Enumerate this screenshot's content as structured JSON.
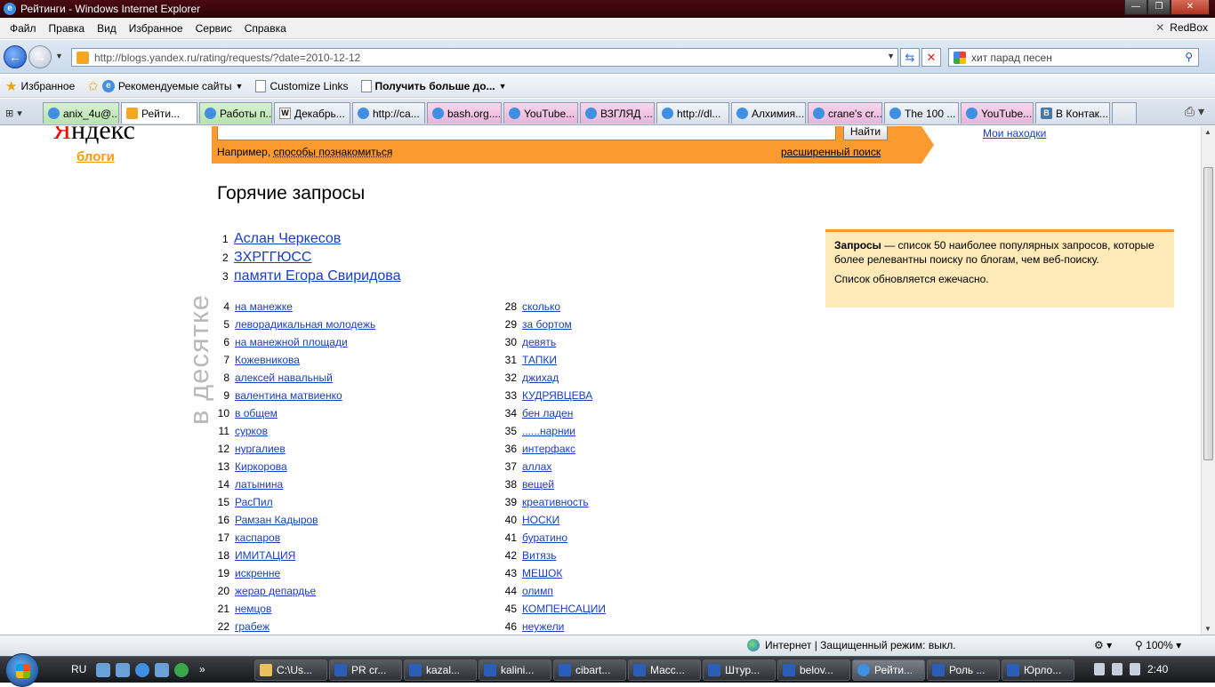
{
  "window": {
    "title": "Рейтинги - Windows Internet Explorer"
  },
  "menu": {
    "items": [
      "Файл",
      "Правка",
      "Вид",
      "Избранное",
      "Сервис",
      "Справка"
    ],
    "redbox": "RedBox"
  },
  "address": {
    "url": "http://blogs.yandex.ru/rating/requests/?date=2010-12-12"
  },
  "websearch": {
    "value": "хит парад песен"
  },
  "favorites": {
    "label": "Избранное",
    "items": [
      "Рекомендуемые сайты",
      "Customize Links",
      "Получить больше до..."
    ]
  },
  "tabs": [
    {
      "label": "anix_4u@...",
      "color": "green"
    },
    {
      "label": "Рейти...",
      "color": "active"
    },
    {
      "label": "Работы п...",
      "color": "green"
    },
    {
      "label": "Декабрь...",
      "color": "plain"
    },
    {
      "label": "http://ca...",
      "color": "plain"
    },
    {
      "label": "bash.org....",
      "color": "pink"
    },
    {
      "label": "YouTube...",
      "color": "pink"
    },
    {
      "label": "ВЗГЛЯД ...",
      "color": "pink"
    },
    {
      "label": "http://dl...",
      "color": "plain"
    },
    {
      "label": "Алхимия...",
      "color": "plain"
    },
    {
      "label": "crane's cr...",
      "color": "pink"
    },
    {
      "label": "The 100 ...",
      "color": "plain"
    },
    {
      "label": "YouTube...",
      "color": "pink"
    },
    {
      "label": "В Контак...",
      "color": "plain"
    }
  ],
  "page": {
    "logo": "Яндекс",
    "logo_sub": "блоги",
    "search_button": "Найти",
    "example_prefix": "Например,",
    "example_link": "способы познакомиться",
    "advanced_search": "расширенный поиск",
    "my_finds": "Мои находки",
    "heading": "Горячие запросы",
    "vertical_label": "в десятке",
    "top3": [
      {
        "n": "1",
        "text": "Аслан Черкесов"
      },
      {
        "n": "2",
        "text": "ЗХРГГЮСС"
      },
      {
        "n": "3",
        "text": "памяти Егора Свиридова"
      }
    ],
    "col1": [
      {
        "n": "4",
        "text": "на манежке"
      },
      {
        "n": "5",
        "text": "леворадикальная молодежь"
      },
      {
        "n": "6",
        "text": "на манежной площади"
      },
      {
        "n": "7",
        "text": "Кожевникова"
      },
      {
        "n": "8",
        "text": "алексей навальный"
      },
      {
        "n": "9",
        "text": "валентина матвиенко"
      },
      {
        "n": "10",
        "text": "в общем"
      },
      {
        "n": "11",
        "text": "сурков"
      },
      {
        "n": "12",
        "text": "нургалиев"
      },
      {
        "n": "13",
        "text": "Киркорова"
      },
      {
        "n": "14",
        "text": "латынина"
      },
      {
        "n": "15",
        "text": "РасПил"
      },
      {
        "n": "16",
        "text": "Рамзан Кадыров"
      },
      {
        "n": "17",
        "text": "каспаров"
      },
      {
        "n": "18",
        "text": "ИМИТАЦИЯ"
      },
      {
        "n": "19",
        "text": "искренне"
      },
      {
        "n": "20",
        "text": "жерар депардье"
      },
      {
        "n": "21",
        "text": "немцов"
      },
      {
        "n": "22",
        "text": "грабеж"
      }
    ],
    "col2": [
      {
        "n": "28",
        "text": "сколько"
      },
      {
        "n": "29",
        "text": "за бортом"
      },
      {
        "n": "30",
        "text": "девять"
      },
      {
        "n": "31",
        "text": "ТАПКИ"
      },
      {
        "n": "32",
        "text": "джихад"
      },
      {
        "n": "33",
        "text": "КУДРЯВЦЕВА"
      },
      {
        "n": "34",
        "text": "бен ладен"
      },
      {
        "n": "35",
        "text": "......нарнии"
      },
      {
        "n": "36",
        "text": "интерфакс"
      },
      {
        "n": "37",
        "text": "аллах"
      },
      {
        "n": "38",
        "text": "вещей"
      },
      {
        "n": "39",
        "text": "креативность"
      },
      {
        "n": "40",
        "text": "НОСКИ"
      },
      {
        "n": "41",
        "text": "буратино"
      },
      {
        "n": "42",
        "text": "Витязь"
      },
      {
        "n": "43",
        "text": "МЕШОК"
      },
      {
        "n": "44",
        "text": "олимп"
      },
      {
        "n": "45",
        "text": "КОМПЕНСАЦИИ"
      },
      {
        "n": "46",
        "text": "неужели"
      }
    ],
    "info_bold": "Запросы",
    "info_text": " — список 50 наиболее популярных запросов, которые более релевантны поиску по блогам, чем веб-поиску.",
    "info_note": "Список обновляется ежечасно."
  },
  "status": {
    "zone": "Интернет | Защищенный режим: выкл.",
    "zoom": "100%"
  },
  "taskbar": {
    "lang": "RU",
    "tasks": [
      {
        "label": "C:\\Us...",
        "icon": "folder"
      },
      {
        "label": "PR cr...",
        "icon": "word"
      },
      {
        "label": "kazal...",
        "icon": "word"
      },
      {
        "label": "kalini...",
        "icon": "word"
      },
      {
        "label": "cibart...",
        "icon": "word"
      },
      {
        "label": "Масс...",
        "icon": "word"
      },
      {
        "label": "Штур...",
        "icon": "word"
      },
      {
        "label": "belov...",
        "icon": "word"
      },
      {
        "label": "Рейти...",
        "icon": "ie"
      },
      {
        "label": "Роль ...",
        "icon": "word"
      },
      {
        "label": "Юрло...",
        "icon": "word"
      }
    ],
    "clock": "2:40"
  },
  "colors": {
    "accent_orange": "#fa9a2f",
    "link": "#1a3dc1",
    "yandex_red": "#ff0000"
  }
}
